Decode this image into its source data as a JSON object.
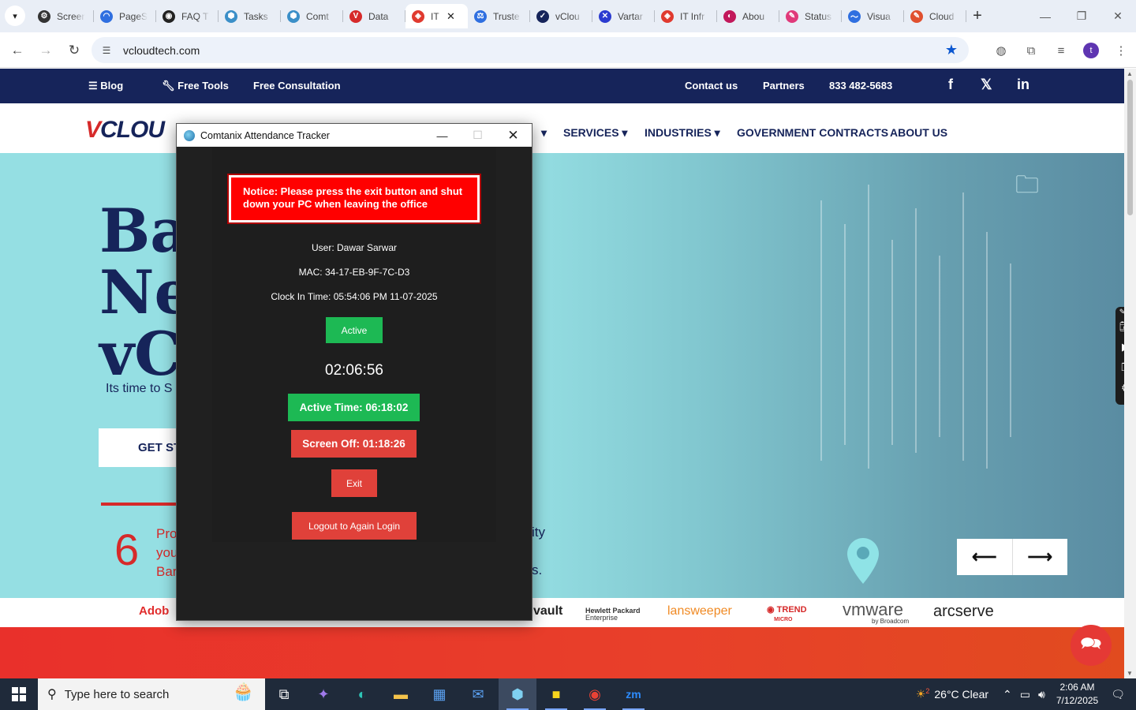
{
  "browser": {
    "tabs": [
      {
        "label": "Screen",
        "color": "#333333",
        "glyph": "⚙"
      },
      {
        "label": "PageS",
        "color": "#2f6fe0",
        "glyph": "◠"
      },
      {
        "label": "FAQ T",
        "color": "#222222",
        "glyph": "◉"
      },
      {
        "label": "Tasks",
        "color": "#3b8fc8",
        "glyph": "⬢"
      },
      {
        "label": "Comt",
        "color": "#3b8fc8",
        "glyph": "⬢"
      },
      {
        "label": "Data",
        "color": "#d62a2a",
        "glyph": "V"
      },
      {
        "label": "IT",
        "color": "#e03a2f",
        "glyph": "◈",
        "active": true
      },
      {
        "label": "Truste",
        "color": "#2f6fe0",
        "glyph": "⚖"
      },
      {
        "label": "vClou",
        "color": "#16245a",
        "glyph": "✓"
      },
      {
        "label": "Vartar",
        "color": "#2b3bd0",
        "glyph": "✕"
      },
      {
        "label": "IT Infr",
        "color": "#e03a2f",
        "glyph": "◈"
      },
      {
        "label": "Abou",
        "color": "#c2185b",
        "glyph": "◐"
      },
      {
        "label": "Status",
        "color": "#e03a7a",
        "glyph": "✎"
      },
      {
        "label": "Visua",
        "color": "#2f6fe0",
        "glyph": "〜"
      },
      {
        "label": "Cloud",
        "color": "#e0502f",
        "glyph": "✎"
      }
    ],
    "url": "vcloudtech.com",
    "profile_initial": "t"
  },
  "site": {
    "topnav": {
      "blog": "Blog",
      "free_tools": "Free Tools",
      "free_consultation": "Free Consultation",
      "contact": "Contact us",
      "partners": "Partners",
      "phone": "833 482-5683"
    },
    "mainnav": {
      "logo_a": "V",
      "logo_b": "CLOU",
      "services": "SERVICES",
      "industries": "INDUSTRIES",
      "government": "GOVERNMENT CONTRACTS",
      "about": "ABOUT US"
    },
    "hero": {
      "title_line1": "Ba",
      "title_line2": "Ne",
      "title_line3": "vC",
      "subtitle": "Its time to S",
      "cta": "GET ST",
      "stat_number": "6",
      "stat_line1": "Pro",
      "stat_line2": "you",
      "stat_line3": "Bar",
      "stat_right1": "ity",
      "stat_right2": "s."
    },
    "brands": {
      "adobe": "Adob",
      "vault": "vault",
      "hpe_1": "Hewlett Packard",
      "hpe_2": "Enterprise",
      "lansweeper": "lansweeper",
      "trend_1": "TREND",
      "trend_2": "MICRO",
      "vmware": "vmware",
      "vmware_sub": "by Broadcom",
      "arcserve": "arcserve"
    }
  },
  "tracker": {
    "title": "Comtanix Attendance Tracker",
    "notice": "Notice: Please press the exit button and shut down your PC when leaving the office",
    "user": "User: Dawar Sarwar",
    "mac": "MAC: 34-17-EB-9F-7C-D3",
    "clock_in": "Clock In Time: 05:54:06 PM 11-07-2025",
    "status": "Active",
    "timer": "02:06:56",
    "active_time": "Active Time: 06:18:02",
    "screen_off": "Screen Off: 01:18:26",
    "exit": "Exit",
    "logout": "Logout to Again Login"
  },
  "taskbar": {
    "search_placeholder": "Type here to search",
    "weather": "26°C  Clear",
    "weather_badge": "2",
    "time": "2:06 AM",
    "date": "7/12/2025"
  },
  "colors": {
    "site_navy": "#16245a",
    "site_red": "#d62a2a",
    "hero_bg": "#95dfe3",
    "tracker_bg": "#202020",
    "active_green": "#1db954",
    "alert_red": "#e0413a"
  }
}
